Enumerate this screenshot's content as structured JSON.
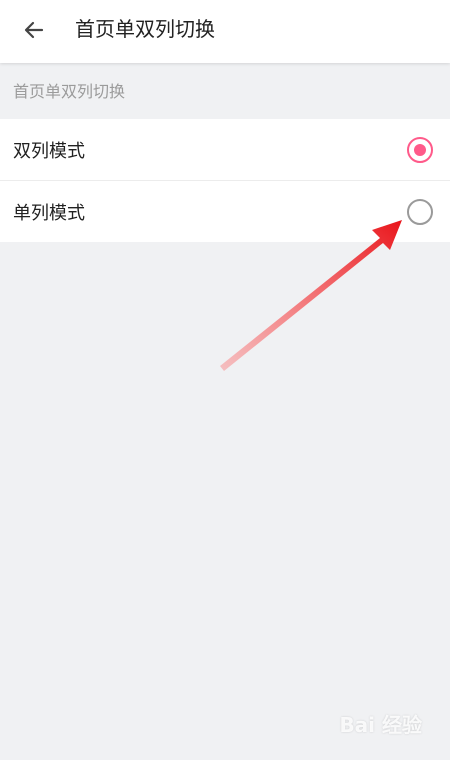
{
  "header": {
    "title": "首页单双列切换",
    "back_icon": "arrow-left-icon"
  },
  "section": {
    "label": "首页单双列切换"
  },
  "options": [
    {
      "label": "双列模式",
      "selected": true
    },
    {
      "label": "单列模式",
      "selected": false
    }
  ],
  "colors": {
    "accent": "#ff5a8a",
    "annotation_arrow": "#e8141a"
  },
  "watermark": "Bai 经验"
}
